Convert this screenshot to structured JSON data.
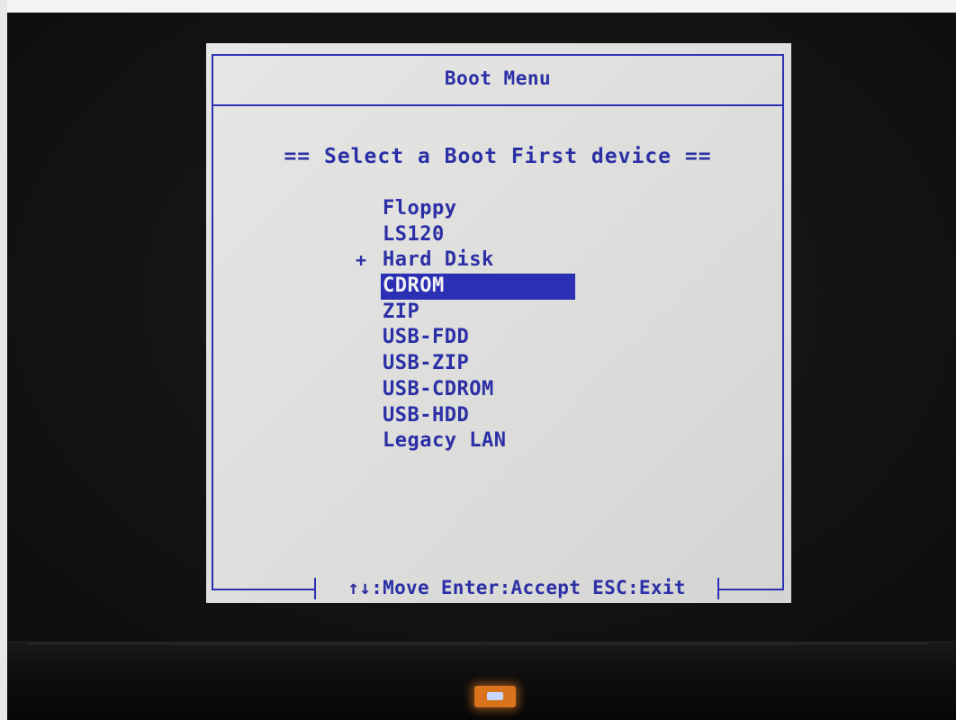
{
  "boot_menu": {
    "title": "Boot Menu",
    "subtitle": "== Select a Boot First device ==",
    "devices": [
      {
        "label": "Floppy",
        "marker": "",
        "selected": false
      },
      {
        "label": "LS120",
        "marker": "",
        "selected": false
      },
      {
        "label": "Hard Disk",
        "marker": "+",
        "selected": false
      },
      {
        "label": "CDROM",
        "marker": "",
        "selected": true
      },
      {
        "label": "ZIP",
        "marker": "",
        "selected": false
      },
      {
        "label": "USB-FDD",
        "marker": "",
        "selected": false
      },
      {
        "label": "USB-ZIP",
        "marker": "",
        "selected": false
      },
      {
        "label": "USB-CDROM",
        "marker": "",
        "selected": false
      },
      {
        "label": "USB-HDD",
        "marker": "",
        "selected": false
      },
      {
        "label": "Legacy LAN",
        "marker": "",
        "selected": false
      }
    ],
    "help": {
      "arrows": "↑↓",
      "move": ":Move",
      "enter": "Enter",
      "accept": ":Accept",
      "esc": "ESC",
      "exit": ":Exit"
    }
  },
  "colors": {
    "text": "#2a2fa6",
    "frame": "#2c30b4",
    "highlight": "#2b2fb3",
    "panel_bg": "#dcdcda",
    "power_led": "#d9741c"
  },
  "icons": {
    "power_led": "power-led-icon"
  }
}
